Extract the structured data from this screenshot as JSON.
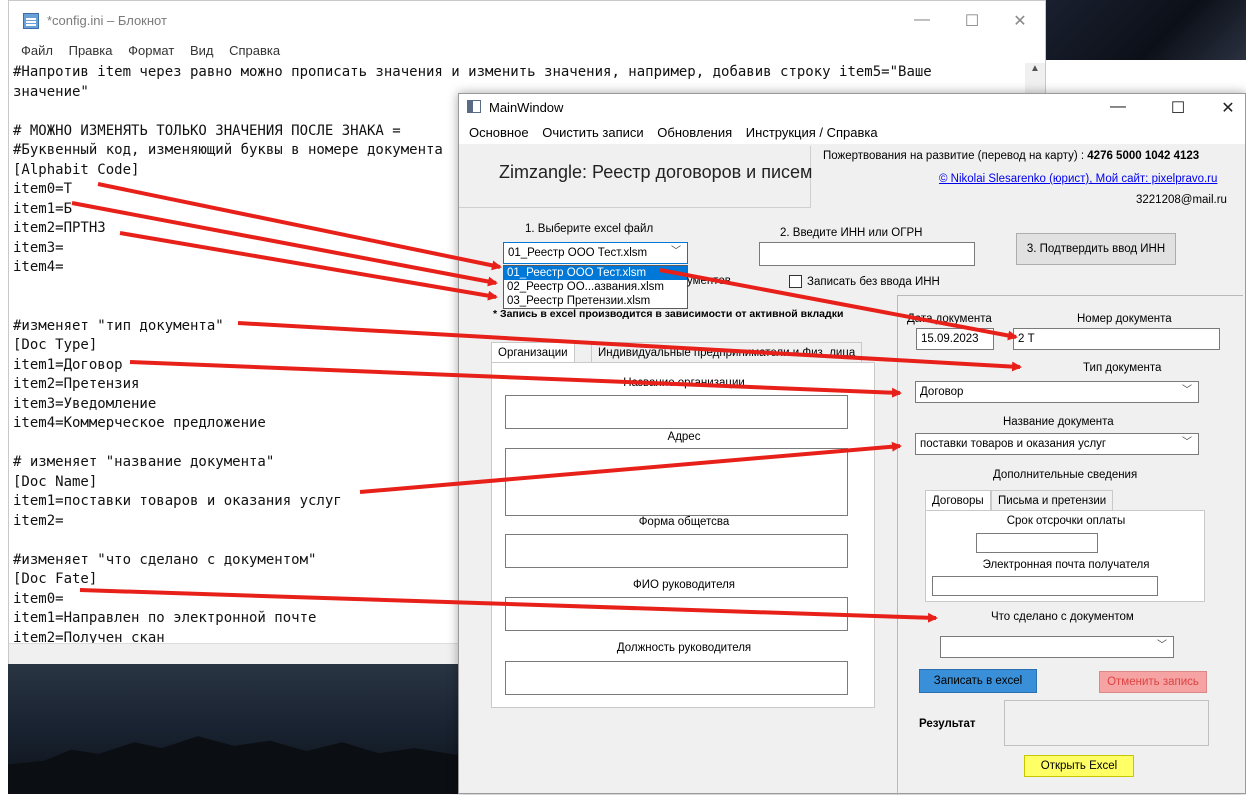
{
  "notepad": {
    "title": "*config.ini – Блокнот",
    "menu": [
      "Файл",
      "Правка",
      "Формат",
      "Вид",
      "Справка"
    ],
    "lines": [
      "#Напротив item через равно можно прописать значения и изменить значения, например, добавив строку item5=\"Ваше",
      "значение\"",
      "",
      "# МОЖНО ИЗМЕНЯТЬ ТОЛЬКО ЗНАЧЕНИЯ ПОСЛЕ ЗНАКА =",
      "#Буквенный код, изменяющий буквы в номере документа",
      "[Alphabit Code]",
      "item0=Т",
      "item1=Б",
      "item2=ПРТНЗ",
      "item3=",
      "item4=",
      "",
      "",
      "#изменяет \"тип документа\"",
      "[Doc Type]",
      "item1=Договор",
      "item2=Претензия",
      "item3=Уведомление",
      "item4=Коммерческое предложение",
      "",
      "# изменяет \"название документа\"",
      "[Doc Name]",
      "item1=поставки товаров и оказания услуг",
      "item2=",
      "",
      "#изменяет \"что сделано с документом\"",
      "[Doc Fate]",
      "item0=",
      "item1=Направлен по электронной почте",
      "item2=Получен скан"
    ]
  },
  "window_controls": {
    "minimize": "—",
    "maximize": "☐",
    "close": "✕"
  },
  "mainwindow": {
    "title": "MainWindow",
    "menu": [
      "Основное",
      "Очистить записи",
      "Обновления",
      "Инструкция / Справка"
    ],
    "app_title": "Zimzangle: Реестр договоров и писем",
    "donation_label": "Пожертвования на развитие (перевод на карту) :",
    "donation_card": "4276 5000 1042 4123",
    "author_link": "© Nikolai Slesarenko (юрист), Мой сайт: pixelpravo.ru",
    "email": "3221208@mail.ru",
    "step1_label": "1. Выберите excel файл",
    "file_combo_value": "01_Реестр ООО Тест.xlsm",
    "file_options": [
      "01_Реестр ООО Тест.xlsm",
      "02_Реестр ОО...азвания.xlsm",
      "03_Реестр Претензии.xlsm"
    ],
    "hidden_label_fragment": "ументов",
    "step2_label": "2. Введите ИНН или ОГРН",
    "inn_value": "",
    "confirm_button": "3. Подтвердить ввод ИНН",
    "write_without_inn": "Записать без ввода ИНН",
    "note": "* Запись в excel  производится в зависимости от активной вкладки",
    "tabs": [
      "Организации",
      "Индивидуальные предприниматели и Физ. лица"
    ],
    "org_fields": [
      "Название организации",
      "Адрес",
      "Форма общетсва",
      "ФИО руководителя",
      "Должность руководителя"
    ],
    "doc_date_label": "Дата документа",
    "doc_date_value": "15.09.2023",
    "doc_number_label": "Номер документа",
    "doc_number_value": "2 Т",
    "doc_type_label": "Тип документа",
    "doc_type_value": "Договор",
    "doc_name_label": "Название документа",
    "doc_name_value": "поставки товаров и оказания услуг",
    "extra_label": "Дополнительные сведения",
    "extra_tabs": [
      "Договоры",
      "Письма и претензии"
    ],
    "payment_delay_label": "Срок отсрочки оплаты",
    "recipient_email_label": "Электронная почта получателя",
    "fate_label": "Что сделано с документом",
    "fate_value": "",
    "write_button": "Записать в excel",
    "cancel_button": "Отменить запись",
    "result_label": "Результат",
    "open_excel_button": "Открыть Excel",
    "colors": {
      "write_button": "#3a8fd9",
      "cancel_button": "#f5a3a3",
      "open_button": "#ffff66",
      "accent": "#0078d7",
      "arrow": "#e8201a"
    }
  }
}
